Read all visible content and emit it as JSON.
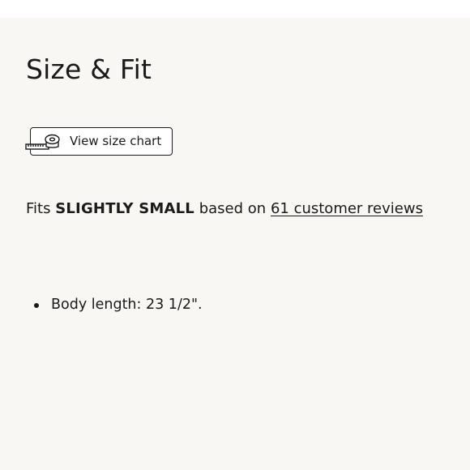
{
  "section": {
    "title": "Size & Fit"
  },
  "size_chart": {
    "button_label": "View size chart",
    "icon": "measuring-tape-icon"
  },
  "fit": {
    "prefix": "Fits",
    "rating": "SLIGHTLY SMALL",
    "middle": "based on",
    "reviews_link": "61 customer reviews"
  },
  "details": [
    "Body length: 23 1/2\"."
  ],
  "colors": {
    "background": "#f9f7f4",
    "text": "#1a1a1a",
    "button_background": "#ffffff"
  }
}
